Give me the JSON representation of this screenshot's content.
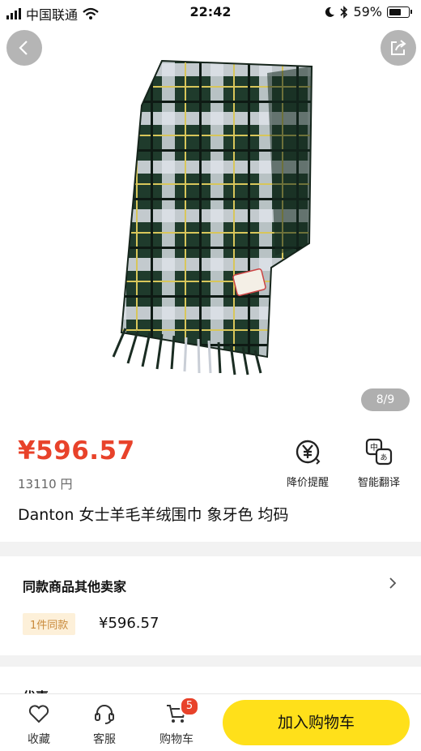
{
  "status_bar": {
    "carrier": "中国联通",
    "time": "22:42",
    "battery": "59%"
  },
  "gallery": {
    "counter": "8/9"
  },
  "product": {
    "price": "¥596.57",
    "original_price": "13110 円",
    "title": "Danton 女士羊毛羊绒围巾 象牙色 均码",
    "actions": [
      {
        "label": "降价提醒",
        "icon": "price-drop-alert-icon"
      },
      {
        "label": "智能翻译",
        "icon": "translate-icon"
      }
    ]
  },
  "other_sellers": {
    "heading": "同款商品其他卖家",
    "badge": "1件同款",
    "price": "¥596.57"
  },
  "promo": {
    "label": "优惠"
  },
  "bottom_bar": {
    "favorite_label": "收藏",
    "service_label": "客服",
    "cart_label": "购物车",
    "cart_count": "5",
    "add_to_cart_label": "加入购物车"
  },
  "colors": {
    "accent_price": "#e8422a",
    "cta_yellow": "#ffe01a",
    "badge_bg": "#fdf0d9"
  }
}
